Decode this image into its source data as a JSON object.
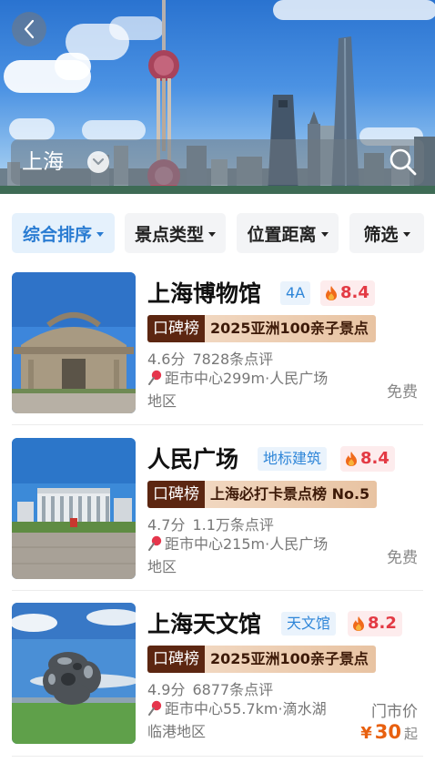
{
  "header": {
    "city": "上海",
    "icons": {
      "back": "chevron-left-icon",
      "dropdown": "chevron-down-icon",
      "search": "search-icon"
    }
  },
  "filters": [
    {
      "label": "综合排序",
      "active": true
    },
    {
      "label": "景点类型",
      "active": false
    },
    {
      "label": "位置距离",
      "active": false
    },
    {
      "label": "筛选",
      "active": false
    }
  ],
  "colors": {
    "accent": "#2a7cd2",
    "hot": "#e33a44",
    "price": "#e8600f",
    "rank_badge": "#5c2611"
  },
  "attractions": [
    {
      "name": "上海博物馆",
      "type_tag": "4A",
      "heat": "8.4",
      "rank_badge": "口碑榜",
      "rank_name": "2025亚洲100亲子景点",
      "score": "4.6分",
      "reviews": "7828条点评",
      "location": "距市中心299m·人民广场地区",
      "price_text": "免费"
    },
    {
      "name": "人民广场",
      "type_tag": "地标建筑",
      "heat": "8.4",
      "rank_badge": "口碑榜",
      "rank_name": "上海必打卡景点榜 No.5",
      "score": "4.7分",
      "reviews": "1.1万条点评",
      "location": "距市中心215m·人民广场地区",
      "price_text": "免费"
    },
    {
      "name": "上海天文馆",
      "type_tag": "天文馆",
      "heat": "8.2",
      "rank_badge": "口碑榜",
      "rank_name": "2025亚洲100亲子景点",
      "score": "4.9分",
      "reviews": "6877条点评",
      "location": "距市中心55.7km·滴水湖临港地区",
      "price_label": "门市价",
      "price_currency": "¥",
      "price_value": "30",
      "price_suffix": "起"
    }
  ]
}
